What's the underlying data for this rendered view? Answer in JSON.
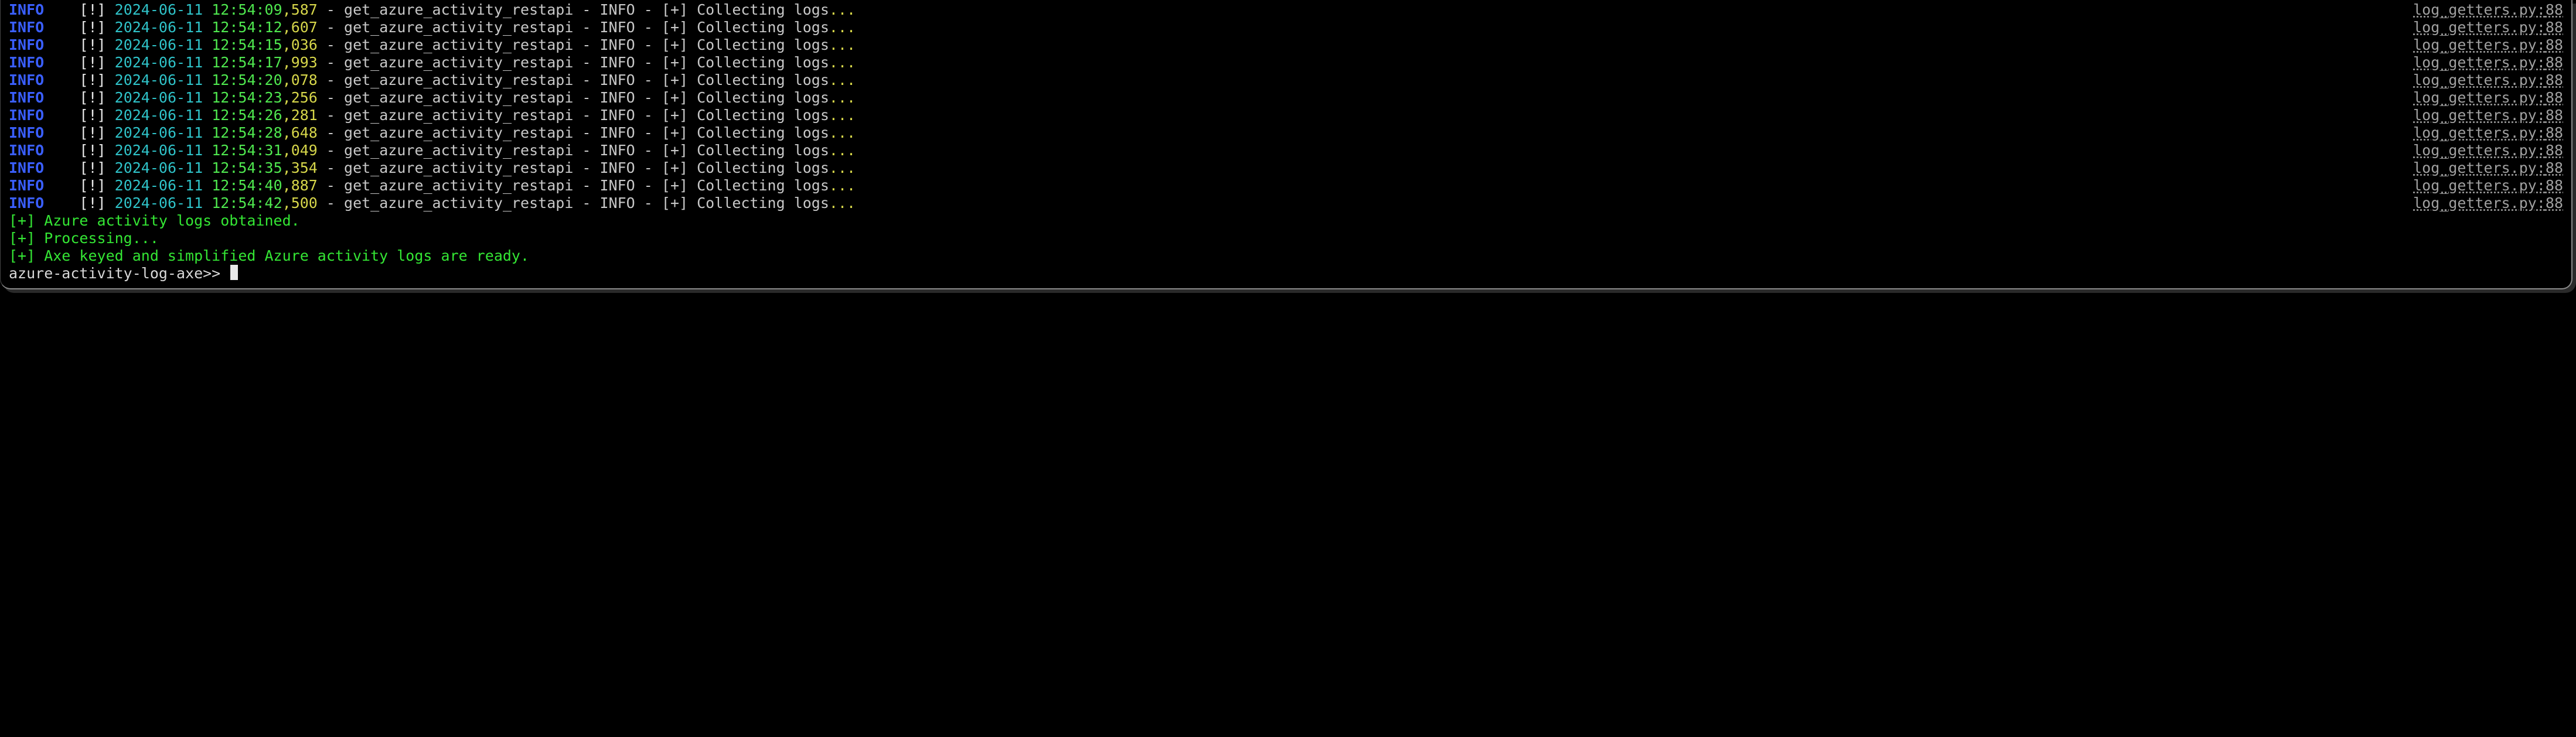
{
  "log_entries": [
    {
      "level": "INFO",
      "bang": "[!]",
      "date": "2024-06-11",
      "time": "12:54:09",
      "ms": "587",
      "source": "get_azure_activity_restapi",
      "level2": "INFO",
      "plus": "[+]",
      "message": "Collecting logs",
      "dots": "...",
      "file": "log_getters.py",
      "lineno": "88"
    },
    {
      "level": "INFO",
      "bang": "[!]",
      "date": "2024-06-11",
      "time": "12:54:12",
      "ms": "607",
      "source": "get_azure_activity_restapi",
      "level2": "INFO",
      "plus": "[+]",
      "message": "Collecting logs",
      "dots": "...",
      "file": "log_getters.py",
      "lineno": "88"
    },
    {
      "level": "INFO",
      "bang": "[!]",
      "date": "2024-06-11",
      "time": "12:54:15",
      "ms": "036",
      "source": "get_azure_activity_restapi",
      "level2": "INFO",
      "plus": "[+]",
      "message": "Collecting logs",
      "dots": "...",
      "file": "log_getters.py",
      "lineno": "88"
    },
    {
      "level": "INFO",
      "bang": "[!]",
      "date": "2024-06-11",
      "time": "12:54:17",
      "ms": "993",
      "source": "get_azure_activity_restapi",
      "level2": "INFO",
      "plus": "[+]",
      "message": "Collecting logs",
      "dots": "...",
      "file": "log_getters.py",
      "lineno": "88"
    },
    {
      "level": "INFO",
      "bang": "[!]",
      "date": "2024-06-11",
      "time": "12:54:20",
      "ms": "078",
      "source": "get_azure_activity_restapi",
      "level2": "INFO",
      "plus": "[+]",
      "message": "Collecting logs",
      "dots": "...",
      "file": "log_getters.py",
      "lineno": "88"
    },
    {
      "level": "INFO",
      "bang": "[!]",
      "date": "2024-06-11",
      "time": "12:54:23",
      "ms": "256",
      "source": "get_azure_activity_restapi",
      "level2": "INFO",
      "plus": "[+]",
      "message": "Collecting logs",
      "dots": "...",
      "file": "log_getters.py",
      "lineno": "88"
    },
    {
      "level": "INFO",
      "bang": "[!]",
      "date": "2024-06-11",
      "time": "12:54:26",
      "ms": "281",
      "source": "get_azure_activity_restapi",
      "level2": "INFO",
      "plus": "[+]",
      "message": "Collecting logs",
      "dots": "...",
      "file": "log_getters.py",
      "lineno": "88"
    },
    {
      "level": "INFO",
      "bang": "[!]",
      "date": "2024-06-11",
      "time": "12:54:28",
      "ms": "648",
      "source": "get_azure_activity_restapi",
      "level2": "INFO",
      "plus": "[+]",
      "message": "Collecting logs",
      "dots": "...",
      "file": "log_getters.py",
      "lineno": "88"
    },
    {
      "level": "INFO",
      "bang": "[!]",
      "date": "2024-06-11",
      "time": "12:54:31",
      "ms": "049",
      "source": "get_azure_activity_restapi",
      "level2": "INFO",
      "plus": "[+]",
      "message": "Collecting logs",
      "dots": "...",
      "file": "log_getters.py",
      "lineno": "88"
    },
    {
      "level": "INFO",
      "bang": "[!]",
      "date": "2024-06-11",
      "time": "12:54:35",
      "ms": "354",
      "source": "get_azure_activity_restapi",
      "level2": "INFO",
      "plus": "[+]",
      "message": "Collecting logs",
      "dots": "...",
      "file": "log_getters.py",
      "lineno": "88"
    },
    {
      "level": "INFO",
      "bang": "[!]",
      "date": "2024-06-11",
      "time": "12:54:40",
      "ms": "887",
      "source": "get_azure_activity_restapi",
      "level2": "INFO",
      "plus": "[+]",
      "message": "Collecting logs",
      "dots": "...",
      "file": "log_getters.py",
      "lineno": "88"
    },
    {
      "level": "INFO",
      "bang": "[!]",
      "date": "2024-06-11",
      "time": "12:54:42",
      "ms": "500",
      "source": "get_azure_activity_restapi",
      "level2": "INFO",
      "plus": "[+]",
      "message": "Collecting logs",
      "dots": "...",
      "file": "log_getters.py",
      "lineno": "88"
    }
  ],
  "status_lines": [
    "[+] Azure activity logs obtained.",
    "[+] Processing...",
    "[+] Axe keyed and simplified Azure activity logs are ready."
  ],
  "prompt": "azure-activity-log-axe>> ",
  "separators": {
    "after_ms": " - ",
    "after_src": " - ",
    "after_lvl2": " - ",
    "comma": ",",
    "space": " ",
    "colon": ":"
  }
}
